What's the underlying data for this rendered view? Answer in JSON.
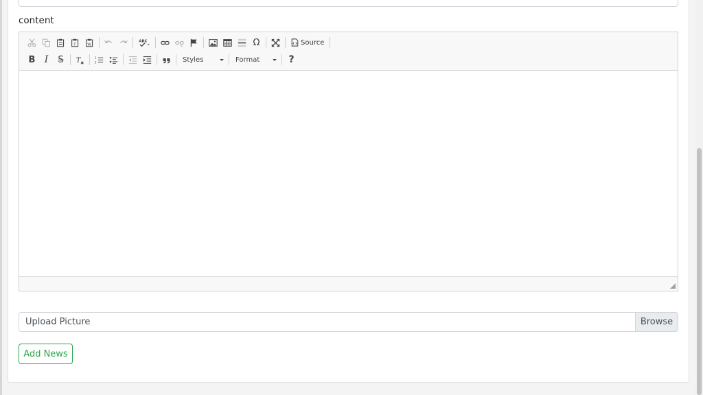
{
  "form": {
    "content_label": "content",
    "upload_placeholder": "Upload Picture",
    "browse_label": "Browse",
    "submit_label": "Add News"
  },
  "editor": {
    "source_label": "Source",
    "styles_label": "Styles",
    "format_label": "Format",
    "help_label": "?",
    "bold": "B",
    "italic": "I",
    "strike": "S",
    "special_char": "Ω"
  },
  "colors": {
    "accent_green": "#28a745",
    "toolbar_bg": "#f8f8f8",
    "border": "#d1d1d1"
  }
}
